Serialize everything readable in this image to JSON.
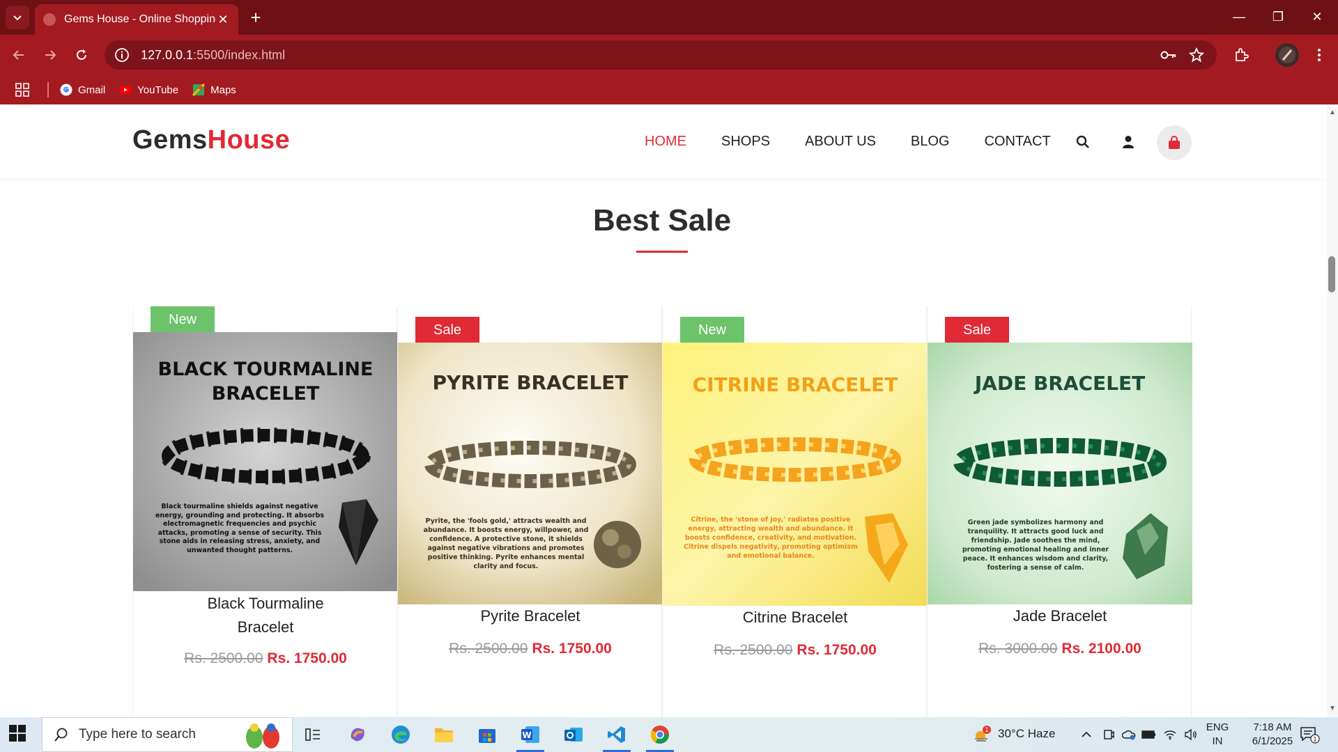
{
  "browser": {
    "tab_title": "Gems House - Online Shopping",
    "url_host": "127.0.0.1",
    "url_path": ":5500/index.html",
    "bookmarks": [
      {
        "label": "Gmail",
        "icon": "gmail-icon"
      },
      {
        "label": "YouTube",
        "icon": "youtube-icon"
      },
      {
        "label": "Maps",
        "icon": "maps-icon"
      }
    ]
  },
  "site": {
    "logo_main": "Gems",
    "logo_accent": "House",
    "nav": [
      "HOME",
      "SHOPS",
      "ABOUT US",
      "BLOG",
      "CONTACT"
    ],
    "active_nav": "HOME"
  },
  "section_title": "Best Sale",
  "products": [
    {
      "badge": "New",
      "name_line1": "Black Tourmaline",
      "name_line2": "Bracelet",
      "old_price": "Rs. 2500.00",
      "new_price": "Rs. 1750.00",
      "image_heading_1": "BLACK TOURMALINE",
      "image_heading_2": "BRACELET",
      "image_text": "Black tourmaline shields against negative energy, grounding and protecting. It absorbs electromagnetic frequencies and psychic attacks, promoting a sense of security. This stone aids in releasing stress, anxiety, and unwanted thought patterns."
    },
    {
      "badge": "Sale",
      "name_line1": "Pyrite Bracelet",
      "old_price": "Rs. 2500.00",
      "new_price": "Rs. 1750.00",
      "image_heading_1": "PYRITE BRACELET",
      "image_text": "Pyrite, the 'fools gold,' attracts wealth and abundance. It boosts energy, willpower, and confidence. A protective stone, it shields against negative vibrations and promotes positive thinking. Pyrite enhances mental clarity and focus."
    },
    {
      "badge": "New",
      "name_line1": "Citrine Bracelet",
      "old_price": "Rs. 2500.00",
      "new_price": "Rs. 1750.00",
      "image_heading_1": "CITRINE BRACELET",
      "image_text": "Citrine, the 'stone of joy,' radiates positive energy, attracting wealth and abundance. It boosts confidence, creativity, and motivation. Citrine dispels negativity, promoting optimism and emotional balance."
    },
    {
      "badge": "Sale",
      "name_line1": "Jade Bracelet",
      "old_price": "Rs. 3000.00",
      "new_price": "Rs. 2100.00",
      "image_heading_1": "JADE BRACELET",
      "image_text": "Green jade symbolizes harmony and tranquility. It attracts good luck and friendship. Jade soothes the mind, promoting emotional healing and inner peace. It enhances wisdom and clarity, fostering a sense of calm."
    }
  ],
  "taskbar": {
    "search_placeholder": "Type here to search",
    "weather": "30°C  Haze",
    "lang_1": "ENG",
    "lang_2": "IN",
    "time": "7:18 AM",
    "date": "6/1/2025",
    "notification_count": "1",
    "weather_badge": "1"
  },
  "colors": {
    "accent": "#e02a35",
    "badge_new": "#6cc36a",
    "badge_sale": "#e02a35",
    "browser_frame": "#a31b21"
  }
}
